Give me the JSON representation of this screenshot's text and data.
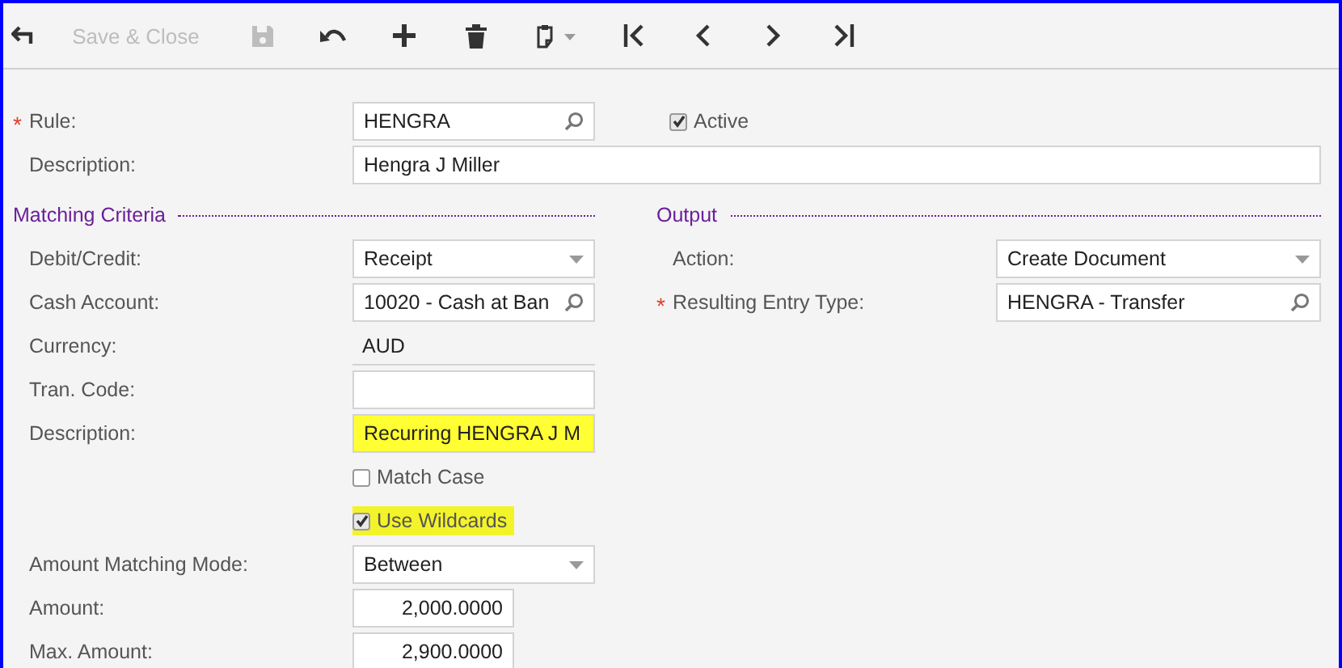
{
  "toolbar": {
    "items": [
      {
        "kind": "back",
        "disabled": false
      },
      {
        "kind": "text",
        "label": "Save & Close",
        "disabled": true
      },
      {
        "kind": "save",
        "disabled": true
      },
      {
        "kind": "undo",
        "disabled": false
      },
      {
        "kind": "add",
        "disabled": false
      },
      {
        "kind": "delete",
        "disabled": false
      },
      {
        "kind": "paste",
        "disabled": false
      },
      {
        "kind": "first",
        "disabled": false
      },
      {
        "kind": "prev",
        "disabled": false
      },
      {
        "kind": "next",
        "disabled": false
      },
      {
        "kind": "last",
        "disabled": false
      }
    ]
  },
  "rule": {
    "label": "Rule:",
    "required_mark": "*",
    "value": "HENGRA",
    "kind": "lookup"
  },
  "active": {
    "label": "Active",
    "checked": true
  },
  "description": {
    "label": "Description:",
    "value": "Hengra J Miller",
    "kind": "text"
  },
  "matching_criteria": {
    "title": "Matching Criteria",
    "rows": [
      {
        "kind": "select",
        "label": "Debit/Credit:",
        "value": "Receipt",
        "highlighted": false
      },
      {
        "kind": "lookup",
        "label": "Cash Account:",
        "value": "10020 - Cash at Ban",
        "highlighted": false
      },
      {
        "kind": "readonly",
        "label": "Currency:",
        "value": "AUD",
        "highlighted": false
      },
      {
        "kind": "text",
        "label": "Tran. Code:",
        "value": "",
        "highlighted": false
      },
      {
        "kind": "text",
        "label": "Description:",
        "value": "Recurring HENGRA J M",
        "highlighted": true
      },
      {
        "kind": "checkbox",
        "label": "Match Case",
        "checked": false,
        "highlighted": false
      },
      {
        "kind": "checkbox",
        "label": "Use Wildcards",
        "checked": true,
        "highlighted": true
      },
      {
        "kind": "select",
        "label": "Amount Matching Mode:",
        "value": "Between",
        "highlighted": false
      },
      {
        "kind": "number",
        "label": "Amount:",
        "value": "2,000.0000",
        "highlighted": false
      },
      {
        "kind": "number",
        "label": "Max. Amount:",
        "value": "2,900.0000",
        "highlighted": false
      }
    ]
  },
  "output": {
    "title": "Output",
    "rows": [
      {
        "kind": "select",
        "label": "Action:",
        "value": "Create Document",
        "highlighted": false
      },
      {
        "kind": "lookup",
        "label": "Resulting Entry Type:",
        "required_mark": "*",
        "value": "HENGRA - Transfer",
        "highlighted": false
      }
    ]
  }
}
